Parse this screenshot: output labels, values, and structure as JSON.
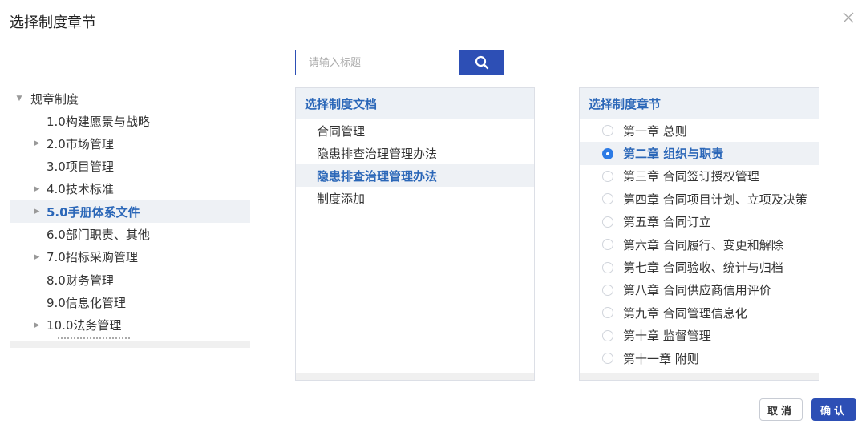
{
  "dialog": {
    "title": "选择制度章节"
  },
  "tree": {
    "root_label": "规章制度",
    "items": [
      {
        "label": "1.0构建愿景与战略",
        "has_children": false
      },
      {
        "label": "2.0市场管理",
        "has_children": true
      },
      {
        "label": "3.0项目管理",
        "has_children": false
      },
      {
        "label": "4.0技术标准",
        "has_children": true
      },
      {
        "label": "5.0手册体系文件",
        "has_children": true,
        "selected": true
      },
      {
        "label": "6.0部门职责、其他",
        "has_children": false
      },
      {
        "label": "7.0招标采购管理",
        "has_children": true
      },
      {
        "label": "8.0财务管理",
        "has_children": false
      },
      {
        "label": "9.0信息化管理",
        "has_children": false
      },
      {
        "label": "10.0法务管理",
        "has_children": true
      }
    ]
  },
  "search": {
    "placeholder": "请输入标题",
    "value": ""
  },
  "documents": {
    "header": "选择制度文档",
    "items": [
      "合同管理",
      "隐患排查治理管理办法",
      "隐患排查治理管理办法",
      "制度添加"
    ],
    "selected_index": 2
  },
  "chapters": {
    "header": "选择制度章节",
    "items": [
      "第一章 总则",
      "第二章 组织与职责",
      "第三章 合同签订授权管理",
      "第四章 合同项目计划、立项及决策",
      "第五章 合同订立",
      "第六章 合同履行、变更和解除",
      "第七章 合同验收、统计与归档",
      "第八章 合同供应商信用评价",
      "第九章 合同管理信息化",
      "第十章 监督管理",
      "第十一章 附则"
    ],
    "selected_index": 1
  },
  "buttons": {
    "cancel": "取消",
    "confirm": "确认"
  },
  "colors": {
    "primary": "#2d4fb5",
    "accent_text": "#2b67b8",
    "radio_checked": "#2d7be5",
    "selected_bg": "#eef1f5"
  },
  "icons": {
    "close": "close-icon",
    "search": "search-icon",
    "expand": "caret-right-icon",
    "collapse": "caret-down-icon"
  }
}
